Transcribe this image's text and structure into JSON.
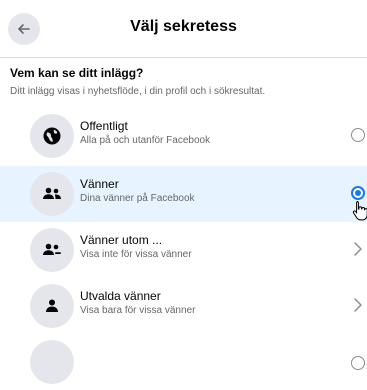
{
  "header": {
    "title": "Välj sekretess"
  },
  "intro": {
    "question": "Vem kan se ditt inlägg?",
    "subtitle": "Ditt inlägg visas i nyhetsflöde, i din profil och i sökresultat."
  },
  "options": [
    {
      "title": "Offentligt",
      "desc": "Alla på och utanför Facebook",
      "icon": "globe-icon",
      "control": "radio",
      "selected": false
    },
    {
      "title": "Vänner",
      "desc": "Dina vänner på Facebook",
      "icon": "friends-icon",
      "control": "radio",
      "selected": true
    },
    {
      "title": "Vänner utom ...",
      "desc": "Visa inte för vissa vänner",
      "icon": "friends-except-icon",
      "control": "chevron",
      "selected": false
    },
    {
      "title": "Utvalda vänner",
      "desc": "Visa bara för vissa vänner",
      "icon": "person-icon",
      "control": "chevron",
      "selected": false
    }
  ],
  "colors": {
    "accent": "#1877f2",
    "selected_bg": "#e7f3ff",
    "icon_bg": "#e4e6eb",
    "muted_text": "#65676b"
  }
}
